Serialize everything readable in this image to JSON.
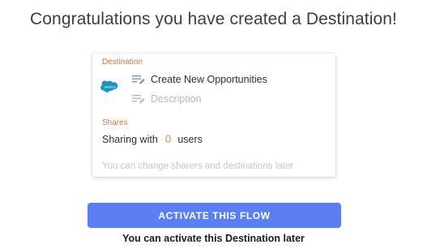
{
  "page": {
    "title": "Congratulations you have created a Destination!"
  },
  "card": {
    "destination_label": "Destination",
    "destination_logo_icon": "salesforce-logo-icon",
    "flow_name": "Create New Opportunities",
    "description_placeholder": "Description",
    "field_icon": "notes-icon",
    "shares_label": "Shares",
    "sharing_prefix": "Sharing with",
    "sharing_count": "0",
    "sharing_suffix": "users",
    "hint": "You can change sharers and destinations later"
  },
  "footer": {
    "activate_button_label": "ACTIVATE THIS FLOW",
    "activate_later_text": "You can activate this Destination later"
  },
  "colors": {
    "accent_orange": "#e0763a",
    "button_blue": "#5b7ff2",
    "salesforce_blue": "#1798c1"
  }
}
